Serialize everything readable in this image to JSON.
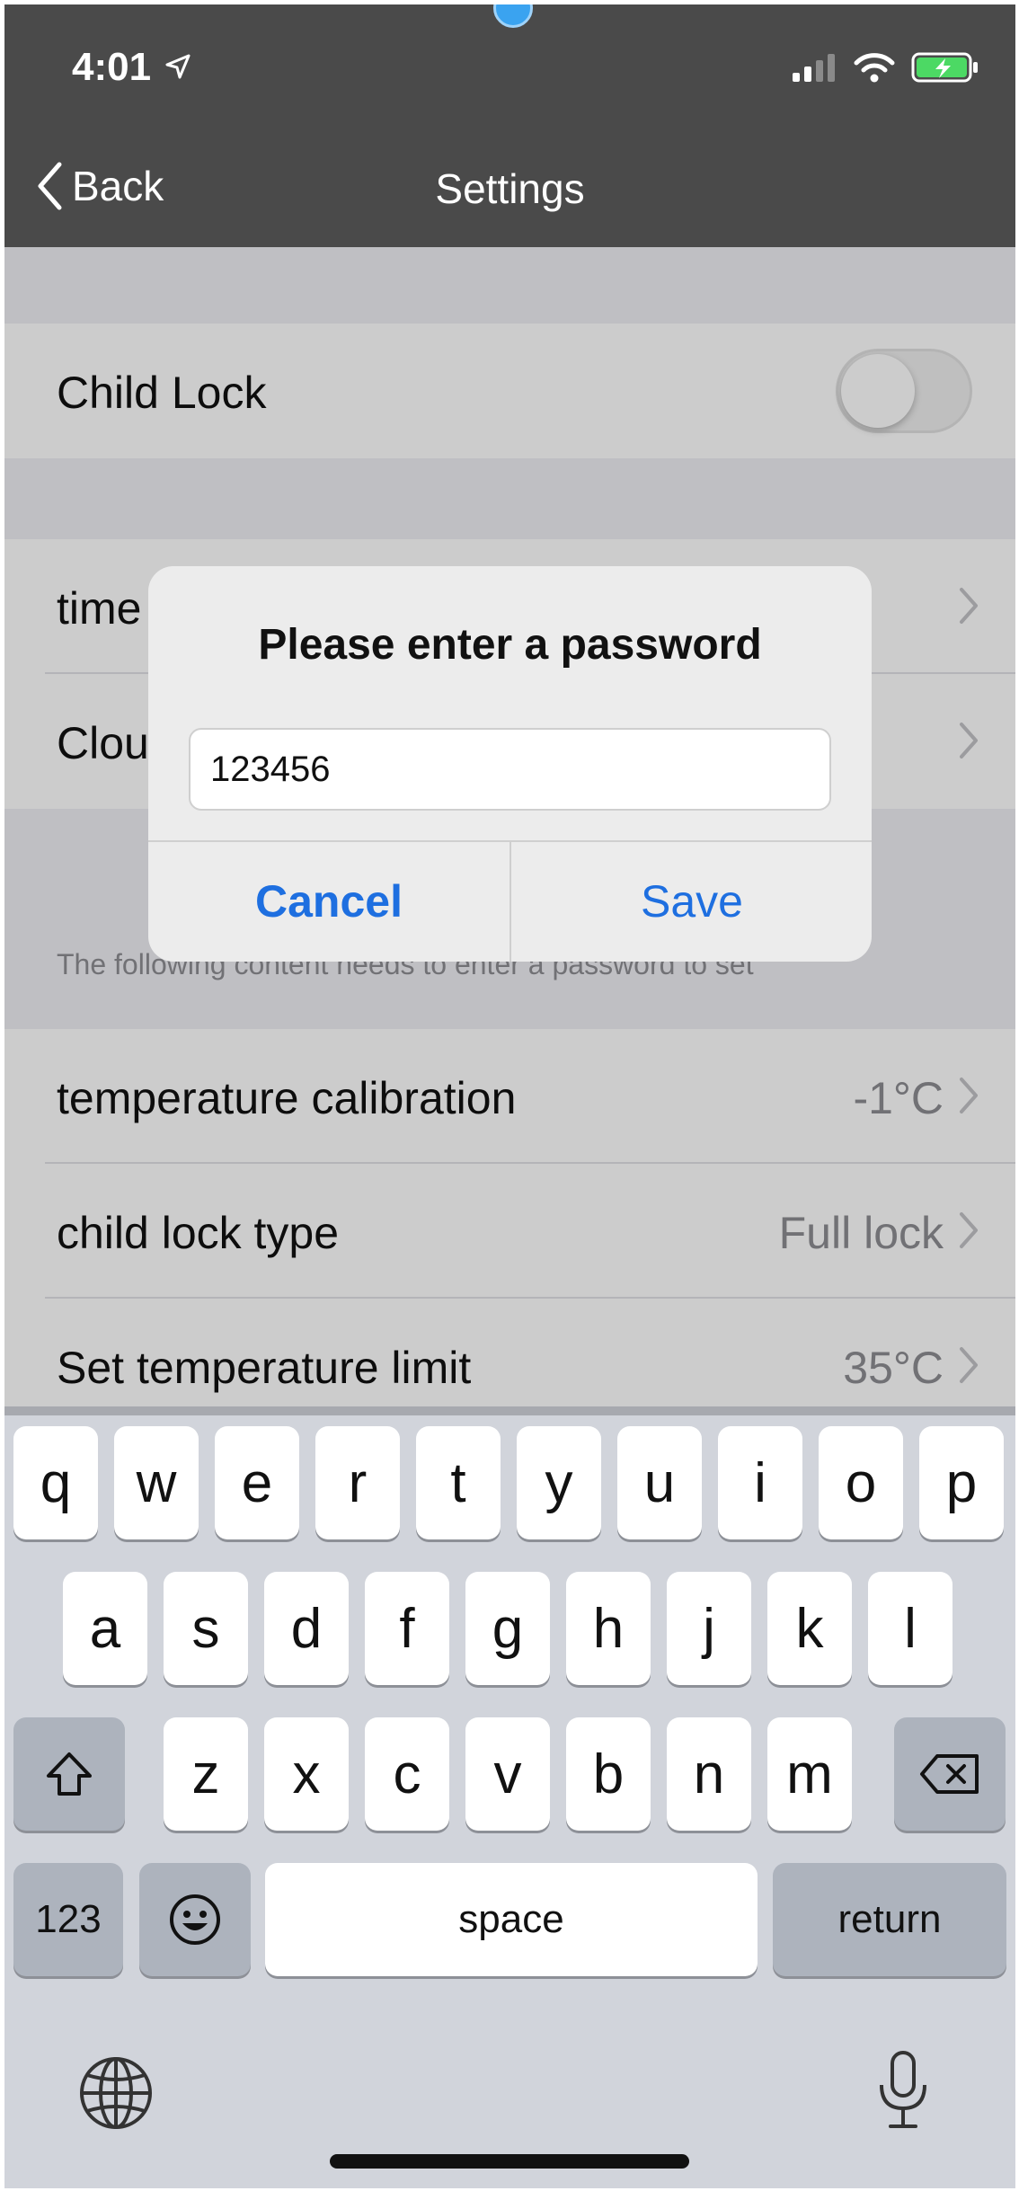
{
  "status_bar": {
    "time": "4:01"
  },
  "nav": {
    "back_label": "Back",
    "title": "Settings"
  },
  "settings": {
    "child_lock_label": "Child Lock",
    "child_lock_on": false,
    "rows_group2": [
      {
        "label": "time"
      },
      {
        "label": "Clou"
      }
    ],
    "footnote": "The following content needs to enter a password to set",
    "protected_rows": [
      {
        "label": "temperature calibration",
        "value": "-1°C"
      },
      {
        "label": "child lock type",
        "value": "Full lock"
      },
      {
        "label": "Set temperature limit",
        "value": "35°C"
      }
    ]
  },
  "alert": {
    "title": "Please enter a password",
    "input_value": "123456",
    "cancel_label": "Cancel",
    "save_label": "Save",
    "accent": "#1e6fe0"
  },
  "keyboard": {
    "row1": [
      "q",
      "w",
      "e",
      "r",
      "t",
      "y",
      "u",
      "i",
      "o",
      "p"
    ],
    "row2": [
      "a",
      "s",
      "d",
      "f",
      "g",
      "h",
      "j",
      "k",
      "l"
    ],
    "row3": [
      "z",
      "x",
      "c",
      "v",
      "b",
      "n",
      "m"
    ],
    "numbers_label": "123",
    "space_label": "space",
    "return_label": "return"
  }
}
